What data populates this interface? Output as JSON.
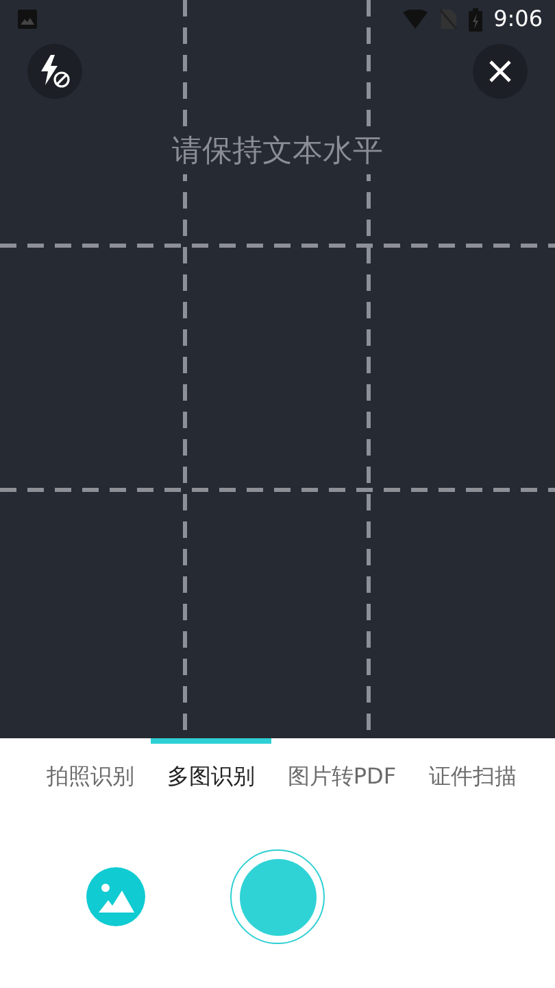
{
  "status_bar": {
    "time": "9:06"
  },
  "viewfinder": {
    "hint": "请保持文本水平",
    "flash_off": true
  },
  "tabs": [
    {
      "label": "拍照识别",
      "selected": false
    },
    {
      "label": "多图识别",
      "selected": true
    },
    {
      "label": "图片转PDF",
      "selected": false
    },
    {
      "label": "证件扫描",
      "selected": false
    }
  ]
}
